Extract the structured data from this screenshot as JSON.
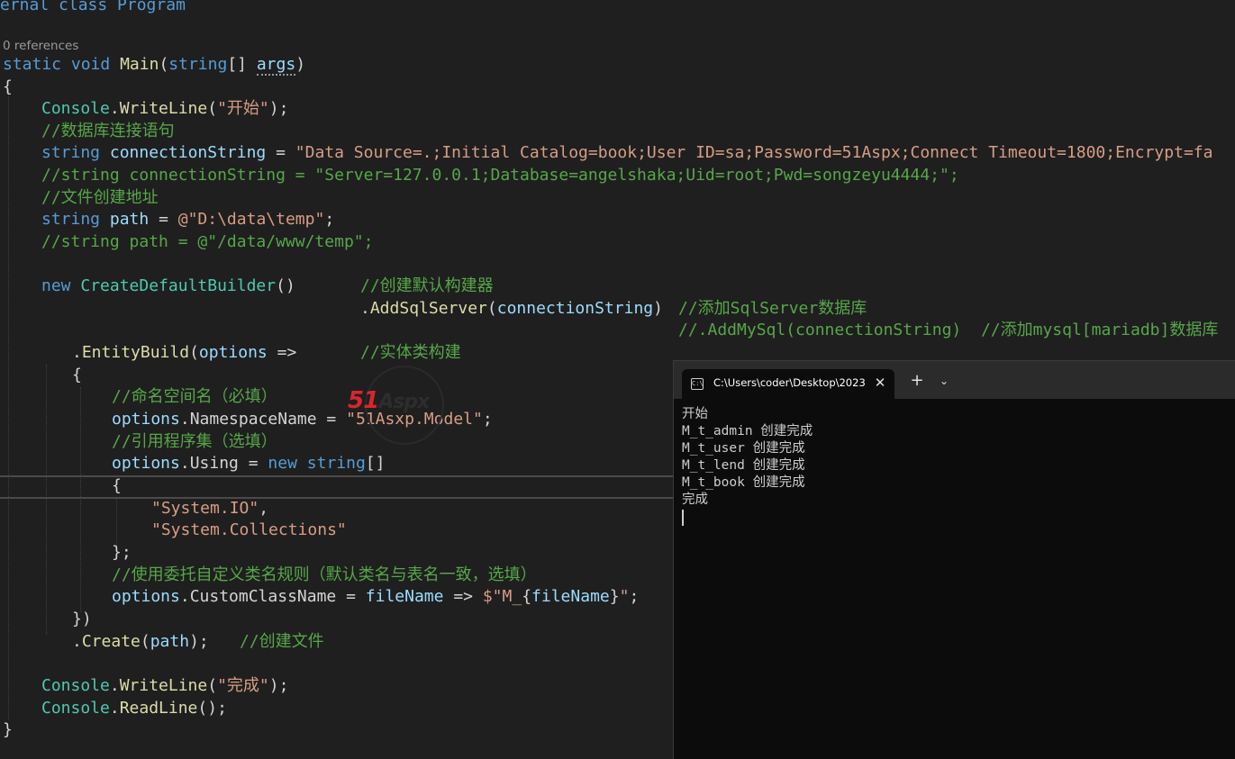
{
  "editor": {
    "header_fragment": "ernal class Program",
    "references": "0 references",
    "main_sig": {
      "static_kw": "static",
      "void_kw": "void",
      "method": "Main",
      "open": "(",
      "string_kw": "string",
      "arr": "[] ",
      "param": "args",
      "close": ")"
    },
    "lines": {
      "brace_open": "{",
      "l1": {
        "cls": "Console",
        "dot": ".",
        "fn": "WriteLine",
        "p1": "(",
        "str": "\"开始\"",
        "p2": ");"
      },
      "c1": "//数据库连接语句",
      "l2": {
        "kw": "string",
        "var": "connectionString",
        "eq": " = ",
        "str": "\"Data Source=.;Initial Catalog=book;User ID=sa;Password=51Aspx;Connect Timeout=1800;Encrypt=fa"
      },
      "c2": "//string connectionString = \"Server=127.0.0.1;Database=angelshaka;Uid=root;Pwd=songzeyu4444;\";",
      "c3": "//文件创建地址",
      "l3": {
        "kw": "string",
        "var": "path",
        "eq": " = ",
        "str": "@\"D:\\data\\temp\"",
        "end": ";"
      },
      "c4": "//string path = @\"/data/www/temp\";",
      "l4": {
        "kw": "new",
        "ty": "CreateDefaultBuilder",
        "p": "()",
        "cm": "//创建默认构建器"
      },
      "l5": {
        "dot": ".",
        "fn": "AddSqlServer",
        "p1": "(",
        "var": "connectionString",
        "p2": ")",
        "cm": "//添加SqlServer数据库"
      },
      "c5": "//.AddMySql(connectionString)  //添加mysql[mariadb]数据库",
      "l6": {
        "dot": ".",
        "fn": "EntityBuild",
        "p1": "(",
        "var": "options",
        "arrow": " =>",
        "cm": "//实体类构建"
      },
      "brace_open2": "{",
      "c6": "//命名空间名（必填）",
      "l7": {
        "var": "options",
        "dot": ".",
        "prop": "NamespaceName",
        "eq": " = ",
        "str": "\"51Asxp.Model\"",
        "end": ";"
      },
      "c7": "//引用程序集（选填）",
      "l8": {
        "var": "options",
        "dot": ".",
        "prop": "Using",
        "eq": " = ",
        "kw": "new",
        "sp": " ",
        "kw2": "string",
        "end": "[]"
      },
      "brace_open3": "{",
      "s1": "\"System.IO\"",
      "s1_end": ",",
      "s2": "\"System.Collections\"",
      "brace_close3": "};",
      "c8": "//使用委托自定义类名规则（默认类名与表名一致，选填）",
      "l9": {
        "var": "options",
        "dot": ".",
        "prop": "CustomClassName",
        "eq": " = ",
        "var2": "fileName",
        "arrow": " => ",
        "str": "$\"M_",
        "interp_open": "{",
        "interp_var": "fileName",
        "interp_close": "}",
        "str2": "\"",
        "end": ";"
      },
      "close_paren": "})",
      "l10": {
        "dot": ".",
        "fn": "Create",
        "p1": "(",
        "var": "path",
        "p2": ");",
        "cm": "//创建文件"
      },
      "l11": {
        "cls": "Console",
        "dot": ".",
        "fn": "WriteLine",
        "p1": "(",
        "str": "\"完成\"",
        "p2": ");"
      },
      "l12": {
        "cls": "Console",
        "dot": ".",
        "fn": "ReadLine",
        "p": "();"
      },
      "brace_close": "}"
    }
  },
  "watermark": {
    "part1": "51",
    "part2": "Aspx"
  },
  "terminal": {
    "tab_title": "C:\\Users\\coder\\Desktop\\2023",
    "tab_icon": "C:\\",
    "close_glyph": "✕",
    "new_tab_glyph": "+",
    "dropdown_glyph": "⌄",
    "output": [
      "开始",
      "M_t_admin 创建完成",
      "M_t_user 创建完成",
      "M_t_lend 创建完成",
      "M_t_book 创建完成",
      "完成"
    ]
  },
  "colors": {
    "keyword": "#569cd6",
    "type": "#4ec9b0",
    "method": "#dcdcaa",
    "variable": "#9cdcfe",
    "string": "#d69d85",
    "comment": "#57a64a",
    "editor_bg": "#1f1f1f",
    "terminal_bg": "#0c0c0c"
  }
}
